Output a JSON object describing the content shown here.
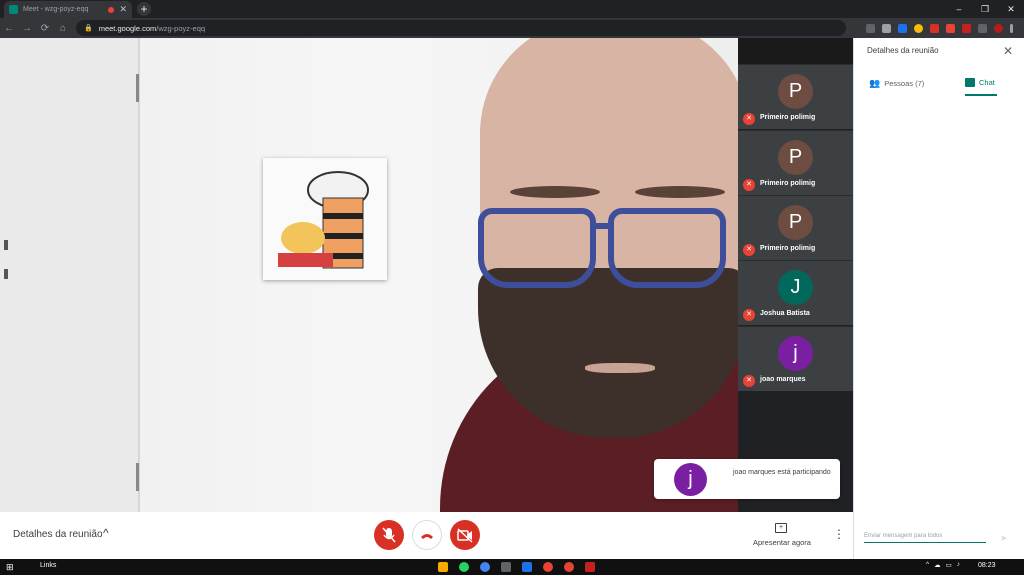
{
  "browser": {
    "tab_title": "Meet - wzg-poyz-eqq",
    "tab_close": "✕",
    "new_tab": "+",
    "window_controls": [
      "–",
      "❐",
      "✕"
    ],
    "nav": [
      "←",
      "→",
      "⟳",
      "⌂"
    ],
    "url_domain": "meet.google.com",
    "url_path": "/wzg-poyz-eqq"
  },
  "participants": [
    {
      "initial": "P",
      "name": "Primeiro polimig",
      "color": "#6d4c41"
    },
    {
      "initial": "P",
      "name": "Primeiro polimig",
      "color": "#6d4c41"
    },
    {
      "initial": "P",
      "name": "Primeiro polimig",
      "color": "#6d4c41"
    },
    {
      "initial": "J",
      "name": "Joshua Batista",
      "color": "#00695c"
    },
    {
      "initial": "j",
      "name": "joao marques",
      "color": "#7b1fa2"
    }
  ],
  "toast": {
    "initial": "j",
    "message": "joao marques está participando"
  },
  "side_panel": {
    "title": "Detalhes da reunião",
    "tab_people": "Pessoas (7)",
    "tab_chat": "Chat",
    "chat_placeholder": "Enviar mensagem para todos"
  },
  "bottom_bar": {
    "meeting_details": "Detalhes da reunião",
    "present_now": "Apresentar agora"
  },
  "taskbar": {
    "links": "Links",
    "clock": "08:23"
  }
}
